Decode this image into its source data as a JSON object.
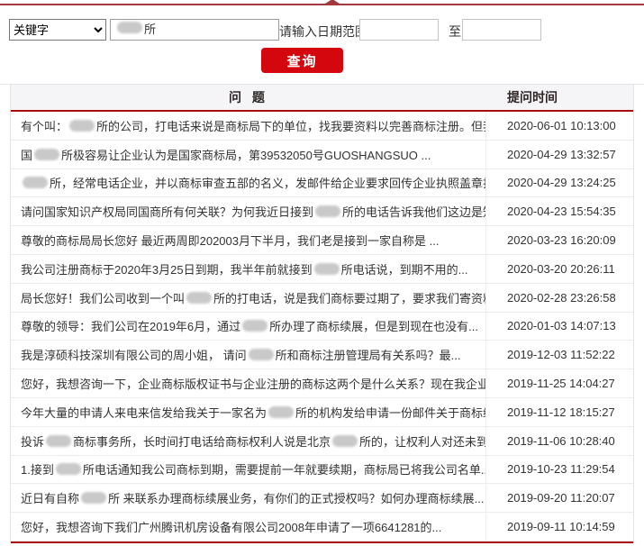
{
  "colors": {
    "top_accent_line": "#a3383e",
    "button_red": "#d3070d",
    "table_divider_red": "#ab0c10",
    "redacted_blob": "#c9c9c9"
  },
  "search": {
    "keyword_select_value": "关键字",
    "keyword_input_segments": [
      {
        "r": 2
      },
      {
        "t": "所"
      }
    ],
    "date_range_label": "请输入日期范围",
    "date_from_value": "",
    "date_to_label": "至",
    "date_to_value": "",
    "submit_label": "查询"
  },
  "table": {
    "headers": {
      "question": "问 题",
      "time": "提问时间"
    },
    "rows": [
      {
        "q": [
          {
            "t": "有个叫："
          },
          {
            "r": 2
          },
          {
            "t": "所的公司，打电话来说是商标局下的单位，找我要资料以完善商标注册。但我..."
          }
        ],
        "time": "2020-06-01 10:13:00"
      },
      {
        "q": [
          {
            "t": "国"
          },
          {
            "r": 2
          },
          {
            "t": "所极容易让企业认为是国家商标局，第39532050号GUOSHANGSUO ..."
          }
        ],
        "time": "2020-04-29 13:32:57"
      },
      {
        "q": [
          {
            "r": 2
          },
          {
            "t": "所，经常电话企业，并以商标审查五部的名义，发邮件给企业要求回传企业执照盖章扫..."
          }
        ],
        "time": "2020-04-29 13:24:25"
      },
      {
        "q": [
          {
            "t": "请问国家知识产权局同国商所有何关联？为何我近日接到"
          },
          {
            "r": 2
          },
          {
            "t": "所的电话告诉我他们这边是知..."
          }
        ],
        "time": "2020-04-23 15:54:35"
      },
      {
        "q": [
          {
            "t": "尊敬的商标局局长您好 最近两周即202003月下半月，我们老是接到一家自称是 ..."
          }
        ],
        "time": "2020-03-23 16:20:09"
      },
      {
        "q": [
          {
            "t": "我公司注册商标于2020年3月25日到期，我半年前就接到"
          },
          {
            "r": 2
          },
          {
            "t": "所电话说，到期不用的..."
          }
        ],
        "time": "2020-03-20 20:26:11"
      },
      {
        "q": [
          {
            "t": "局长您好！我们公司收到一个叫"
          },
          {
            "r": 2
          },
          {
            "t": "所的打电话，说是我们商标要过期了，要求我们寄资料..."
          }
        ],
        "time": "2020-02-28 23:26:58"
      },
      {
        "q": [
          {
            "t": "尊敬的领导：我们公司在2019年6月，通过"
          },
          {
            "r": 2
          },
          {
            "t": "所办理了商标续展，但是到现在也没有..."
          }
        ],
        "time": "2020-01-03 14:07:13"
      },
      {
        "q": [
          {
            "t": "我是淳硕科技深圳有限公司的周小姐， 请问"
          },
          {
            "r": 2
          },
          {
            "t": "所和商标注册管理局有关系吗？最..."
          }
        ],
        "time": "2019-12-03 11:52:22"
      },
      {
        "q": [
          {
            "t": "您好，我想咨询一下，企业商标版权证书与企业注册的商标这两个是什么关系？现在我企业..."
          }
        ],
        "time": "2019-11-25 14:04:27"
      },
      {
        "q": [
          {
            "t": "今年大量的申请人来电来信发给我关于一家名为"
          },
          {
            "r": 2
          },
          {
            "t": "所的机构发给申请一份邮件关于商标续..."
          }
        ],
        "time": "2019-11-12 18:15:27"
      },
      {
        "q": [
          {
            "t": "投诉"
          },
          {
            "r": 2
          },
          {
            "t": "商标事务所，长时间打电话给商标权利人说是北京"
          },
          {
            "r": 2
          },
          {
            "t": "所的，让权利人对还未到续..."
          }
        ],
        "time": "2019-11-06 10:28:40"
      },
      {
        "q": [
          {
            "t": "1.接到"
          },
          {
            "r": 2
          },
          {
            "t": "所电话通知我公司商标到期，需要提前一年就要续期，商标局已将我公司名单..."
          }
        ],
        "time": "2019-10-23 11:29:54"
      },
      {
        "q": [
          {
            "t": "近日有自称 "
          },
          {
            "r": 2
          },
          {
            "t": "所 来联系办理商标续展业务，有你们的正式授权吗？如何办理商标续展..."
          }
        ],
        "time": "2019-09-20 11:20:07"
      },
      {
        "q": [
          {
            "t": "您好，我想咨询下我们广州腾讯机房设备有限公司2008年申请了一项6641281的..."
          }
        ],
        "time": "2019-09-11 10:14:59"
      }
    ]
  }
}
